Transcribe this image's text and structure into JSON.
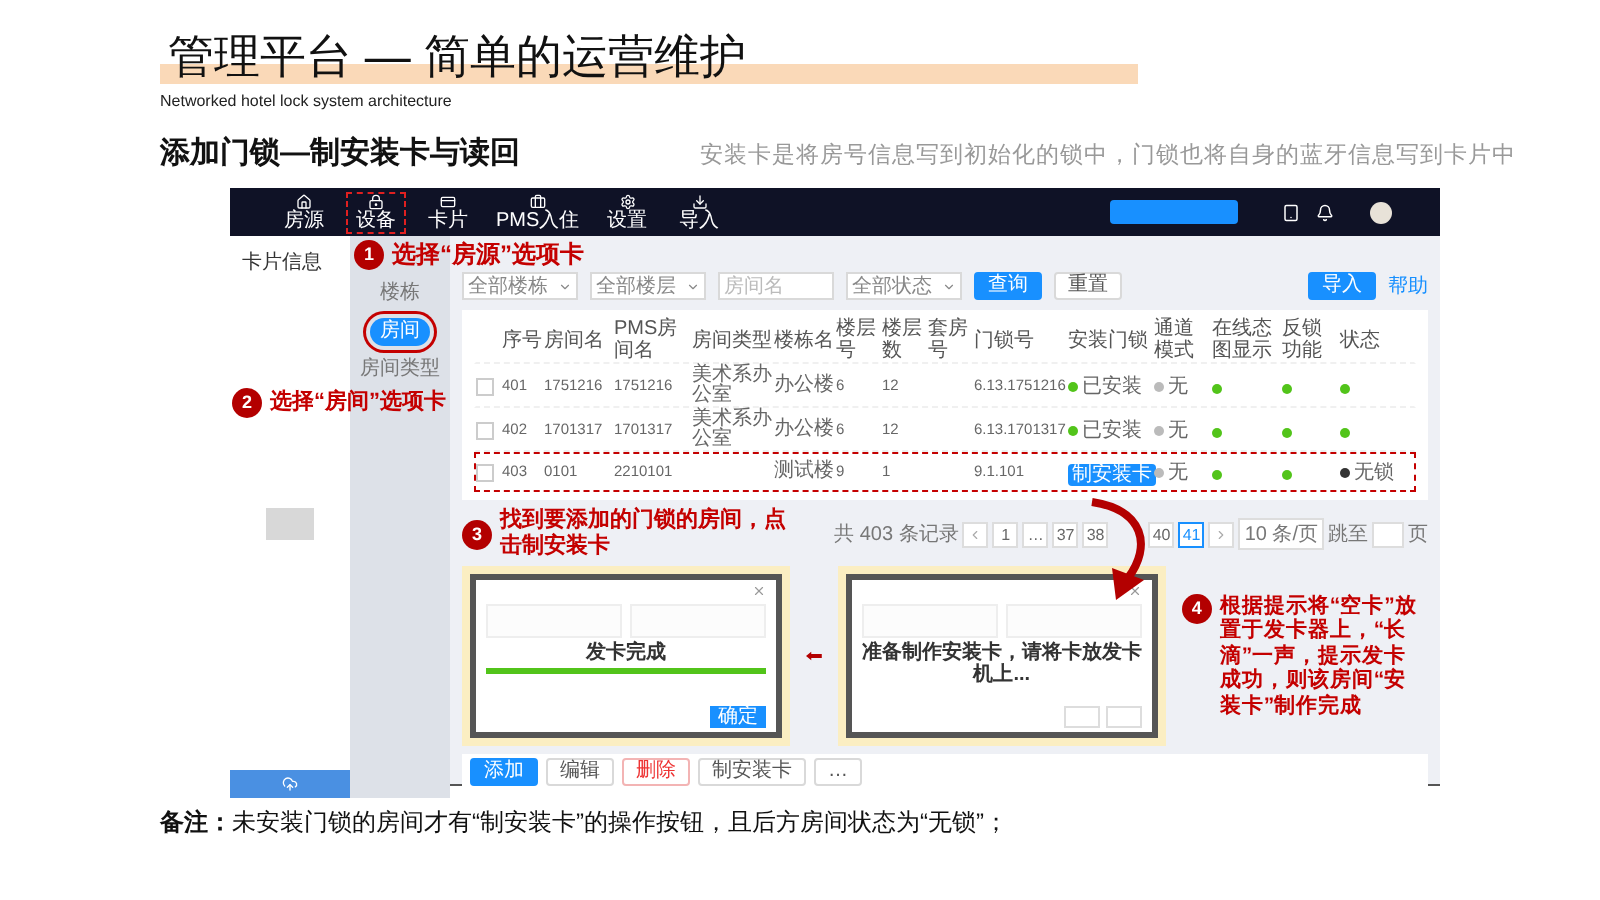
{
  "title": "管理平台 — 简单的运营维护",
  "subtitle": "Networked hotel lock system architecture",
  "section": {
    "heading": "添加门锁—制安装卡与读回",
    "note": "安装卡是将房号信息写到初始化的锁中，门锁也将自身的蓝牙信息写到卡片中"
  },
  "app": {
    "nav": [
      {
        "label": "房源",
        "highlighted": false
      },
      {
        "label": "设备",
        "highlighted": true
      },
      {
        "label": "卡片",
        "highlighted": false
      },
      {
        "label": "PMS入住",
        "highlighted": false
      },
      {
        "label": "设置",
        "highlighted": false
      },
      {
        "label": "导入",
        "highlighted": false
      }
    ],
    "left_title": "卡片信息",
    "sidebar": [
      {
        "label": "楼栋",
        "selected": false,
        "highlighted": false
      },
      {
        "label": "房间",
        "selected": true,
        "highlighted": true
      },
      {
        "label": "房间类型",
        "selected": false,
        "highlighted": false
      }
    ],
    "filters": [
      {
        "kind": "select",
        "value": "全部楼栋"
      },
      {
        "kind": "select",
        "value": "全部楼层"
      },
      {
        "kind": "input",
        "placeholder": "房间名"
      },
      {
        "kind": "select",
        "value": "全部状态"
      }
    ],
    "filter_buttons": [
      {
        "label": "查询",
        "kind": "primary"
      },
      {
        "label": "重置",
        "kind": "default"
      }
    ],
    "import_button": "导入",
    "help_link": "帮助",
    "table": {
      "columns": [
        "序号",
        "房间名",
        "PMS房间名",
        "房间类型",
        "楼栋名",
        "楼层号",
        "楼层数",
        "套房号",
        "门锁号",
        "安装门锁",
        "通道模式",
        "在线态图显示",
        "反锁功能",
        "状态"
      ],
      "rows": [
        {
          "checked": false,
          "highlighted": false,
          "cells": [
            {
              "kind": "text",
              "text": "401"
            },
            {
              "kind": "text",
              "text": "1751216"
            },
            {
              "kind": "text",
              "text": "1751216"
            },
            {
              "kind": "text",
              "text": "美术系办公室"
            },
            {
              "kind": "text",
              "text": "办公楼"
            },
            {
              "kind": "text",
              "text": "6"
            },
            {
              "kind": "text",
              "text": "12"
            },
            {
              "kind": "blank"
            },
            {
              "kind": "text",
              "text": "6.13.1751216"
            },
            {
              "kind": "status",
              "text": "已安装",
              "color": "#52c41a"
            },
            {
              "kind": "status",
              "text": "无",
              "color": "#bbbbbb"
            },
            {
              "kind": "dot",
              "color": "#52c41a"
            },
            {
              "kind": "dot",
              "color": "#52c41a"
            },
            {
              "kind": "dot",
              "color": "#52c41a"
            }
          ]
        },
        {
          "checked": false,
          "highlighted": false,
          "cells": [
            {
              "kind": "text",
              "text": "402"
            },
            {
              "kind": "text",
              "text": "1701317"
            },
            {
              "kind": "text",
              "text": "1701317"
            },
            {
              "kind": "text",
              "text": "美术系办公室"
            },
            {
              "kind": "text",
              "text": "办公楼"
            },
            {
              "kind": "text",
              "text": "6"
            },
            {
              "kind": "text",
              "text": "12"
            },
            {
              "kind": "blank"
            },
            {
              "kind": "text",
              "text": "6.13.1701317"
            },
            {
              "kind": "status",
              "text": "已安装",
              "color": "#52c41a"
            },
            {
              "kind": "status",
              "text": "无",
              "color": "#bbbbbb"
            },
            {
              "kind": "dot",
              "color": "#52c41a"
            },
            {
              "kind": "dot",
              "color": "#52c41a"
            },
            {
              "kind": "dot",
              "color": "#52c41a"
            }
          ]
        },
        {
          "checked": false,
          "highlighted": true,
          "cells": [
            {
              "kind": "text",
              "text": "403"
            },
            {
              "kind": "text",
              "text": "0101"
            },
            {
              "kind": "text",
              "text": "2210101"
            },
            {
              "kind": "blank"
            },
            {
              "kind": "text",
              "text": "测试楼"
            },
            {
              "kind": "text",
              "text": "9"
            },
            {
              "kind": "text",
              "text": "1"
            },
            {
              "kind": "blank"
            },
            {
              "kind": "text",
              "text": "9.1.101"
            },
            {
              "kind": "action",
              "text": "制安装卡"
            },
            {
              "kind": "status",
              "text": "无",
              "color": "#bbbbbb"
            },
            {
              "kind": "dot",
              "color": "#52c41a"
            },
            {
              "kind": "dot",
              "color": "#52c41a"
            },
            {
              "kind": "status",
              "text": "无锁",
              "color": "#333333"
            }
          ]
        }
      ]
    },
    "pagination": {
      "total": "共 403 条记录",
      "pages": [
        {
          "label": "1",
          "selected": false
        },
        {
          "label": "…",
          "selected": false
        },
        {
          "label": "37",
          "selected": false
        },
        {
          "label": "38",
          "selected": false
        },
        {
          "label": "40",
          "selected": false
        },
        {
          "label": "41",
          "selected": true
        }
      ],
      "page_size": "10 条/页",
      "jump_label": "跳至",
      "jump_suffix": "页"
    },
    "modals": [
      {
        "kind": "done",
        "message": "发卡完成",
        "level": 1,
        "button": "确定"
      },
      {
        "kind": "prepare",
        "message": "准备制作安装卡，请将卡放发卡机上..."
      }
    ],
    "actions": [
      {
        "label": "添加",
        "kind": "primary"
      },
      {
        "label": "编辑",
        "kind": "default"
      },
      {
        "label": "删除",
        "kind": "danger"
      },
      {
        "label": "制安装卡",
        "kind": "default"
      },
      {
        "label": "…",
        "kind": "default"
      }
    ]
  },
  "callouts": [
    {
      "number": "1",
      "text": "选择“房源”选项卡"
    },
    {
      "number": "2",
      "text": "选择“房间”选项卡"
    },
    {
      "number": "3",
      "text": "找到要添加的门锁的房间，点击制安装卡"
    },
    {
      "number": "4",
      "text": "根据提示将“空卡”放置于发卡器上，“长滴”一声，提示发卡成功，则该房间“安装卡”制作完成"
    }
  ],
  "footnote": "**备注：**未安装门锁的房间才有“制安装卡”的操作按钮，且后方房间状态为“无锁”；"
}
